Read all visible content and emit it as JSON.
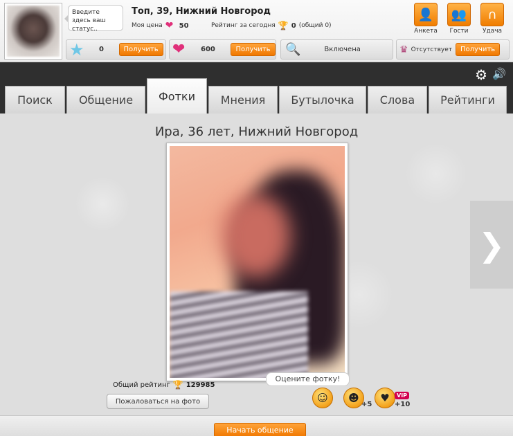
{
  "profile": {
    "status_placeholder": "Введите здесь ваш статус..",
    "title": "Топ, 39, Нижний Новгород",
    "price_label": "Моя цена",
    "price_value": "50",
    "rating_today_label": "Рейтинг за сегодня",
    "rating_today_value": "0",
    "rating_total_note": "(общий 0)"
  },
  "top_icons": [
    {
      "label": "Анкета",
      "icon": "profile-icon"
    },
    {
      "label": "Гости",
      "icon": "guests-icon"
    },
    {
      "label": "Удача",
      "icon": "horseshoe-icon"
    }
  ],
  "bars": {
    "stars_value": "0",
    "stars_button": "Получить",
    "hearts_value": "600",
    "hearts_button": "Получить",
    "visibility_status": "Включена",
    "vip_status": "Отсутствует",
    "vip_button": "Получить"
  },
  "tabs": [
    "Поиск",
    "Общение",
    "Фотки",
    "Мнения",
    "Бутылочка",
    "Слова",
    "Рейтинги"
  ],
  "active_tab": "Фотки",
  "photo": {
    "person_title": "Ира, 36 лет, Нижний Новгород",
    "rating_label": "Общий рейтинг",
    "rating_value": "129985",
    "report_button": "Пожаловаться на фото",
    "rate_prompt": "Оцените фотку!",
    "rate_plus_5": "+5",
    "rate_plus_10": "+10",
    "vip_tag": "VIP"
  },
  "footer": {
    "start_button": "Начать общение"
  },
  "colors": {
    "accent": "#f07800",
    "dark_strip": "#2f2f2f",
    "heart": "#e0307a"
  }
}
